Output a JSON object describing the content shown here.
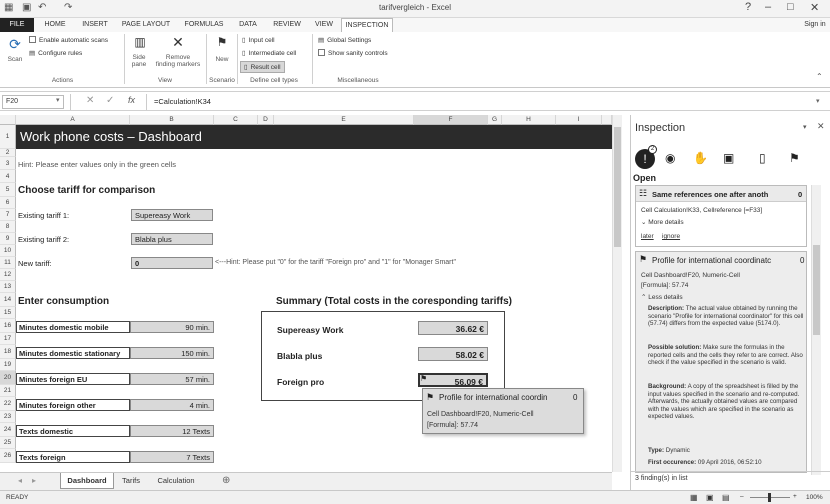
{
  "window": {
    "title": "tarifvergleich - Excel",
    "sign_in": "Sign in"
  },
  "ribbon_tabs": [
    "FILE",
    "HOME",
    "INSERT",
    "PAGE LAYOUT",
    "FORMULAS",
    "DATA",
    "REVIEW",
    "VIEW",
    "INSPECTION"
  ],
  "ribbon": {
    "scan": "Scan",
    "enable_auto": "Enable automatic scans",
    "configure_rules": "Configure rules",
    "actions": "Actions",
    "side_pane_1": "Side",
    "side_pane_2": "pane",
    "remove_1": "Remove",
    "remove_2": "finding markers",
    "view": "View",
    "new": "New",
    "scenario": "Scenario",
    "input_cell": "Input cell",
    "intermediate_cell": "Intermediate cell",
    "result_cell": "Result cell",
    "define_cell_types": "Define cell types",
    "global_settings": "Global Settings",
    "show_sanity": "Show sanity controls",
    "misc": "Miscellaneous"
  },
  "formula": {
    "namebox": "F20",
    "fx": "fx",
    "value": "=Calculation!K34"
  },
  "columns": [
    "A",
    "B",
    "C",
    "D",
    "E",
    "F",
    "G",
    "H",
    "I"
  ],
  "rows": [
    "1",
    "2",
    "3",
    "4",
    "5",
    "6",
    "7",
    "8",
    "9",
    "10",
    "11",
    "12",
    "13",
    "14",
    "15",
    "16",
    "17",
    "18",
    "19",
    "20",
    "21",
    "22",
    "23",
    "24",
    "25",
    "26"
  ],
  "sheet": {
    "title": "Work phone costs – Dashboard",
    "hint": "Hint: Please enter values only in the green cells",
    "choose": "Choose tariff for comparison",
    "existing1_label": "Existing tariff 1:",
    "existing1_val": "Supereasy Work",
    "existing2_label": "Existing tariff 2:",
    "existing2_val": "Blabla plus",
    "new_label": "New tariff:",
    "new_val": "0",
    "new_hint": "<---Hint: Please put \"0\" for the tariff \"Foreign pro\" and \"1\" for \"Monager Smart\"",
    "enter_consumption": "Enter consumption",
    "consumption": [
      {
        "label": "Minutes domestic mobile",
        "value": "90 min."
      },
      {
        "label": "Minutes domestic stationary",
        "value": "150 min."
      },
      {
        "label": "Minutes foreign EU",
        "value": "57 min."
      },
      {
        "label": "Minutes foreign other",
        "value": "4 min."
      },
      {
        "label": "Texts domestic",
        "value": "12 Texts"
      },
      {
        "label": "Texts foreign",
        "value": "7 Texts"
      }
    ],
    "summary_title": "Summary (Total costs in the coresponding tariffs)",
    "summary": [
      {
        "label": "Supereasy Work",
        "value": "36.62 €"
      },
      {
        "label": "Blabla plus",
        "value": "58.02 €"
      },
      {
        "label": "Foreign pro",
        "value": "56.09 €"
      }
    ]
  },
  "popup": {
    "title": "Profile for international coordin",
    "count": "0",
    "line1": "Cell Dashboard!F20, Numeric-Cell",
    "line2": "[Formula]: 57.74"
  },
  "sheet_tabs": [
    "Dashboard",
    "Tarifs",
    "Calculation"
  ],
  "status": {
    "ready": "READY",
    "zoom": "100%"
  },
  "pane": {
    "title": "Inspection",
    "badge": "2",
    "open": "Open",
    "f1": {
      "title": "Same references one after anoth",
      "count": "0",
      "line": "Cell Calculation!K33, Cellreference [=F33]",
      "more": "More details",
      "later": "later",
      "ignore": "ignore"
    },
    "f2": {
      "title": "Profile for international coordinatc",
      "count": "0",
      "line1": "Cell Dashboard!F20, Numeric-Cell",
      "line2": "[Formula]: 57.74",
      "less": "Less details",
      "desc_label": "Description:",
      "desc": "The actual value obtained by running the scenario \"Profile for international coordinator\" for this cell (57.74) differs from the expected value (5174.0).",
      "sol_label": "Possible solution:",
      "sol": "Make sure the formulas in the reported cells and the cells they refer to are correct. Also check if the value specified in the scenario is valid.",
      "bg_label": "Background:",
      "bg": "A copy of the spreadsheet is filled by the input values specified in the scenario and re-computed. Afterwards, the actually obtained values are compared with the values which are specified in the scenario as expected values.",
      "type_label": "Type:",
      "type": "Dynamic",
      "first_label": "First occurence:",
      "first": "09 April 2016, 06:52:10"
    },
    "footer": "3 finding(s) in list"
  }
}
